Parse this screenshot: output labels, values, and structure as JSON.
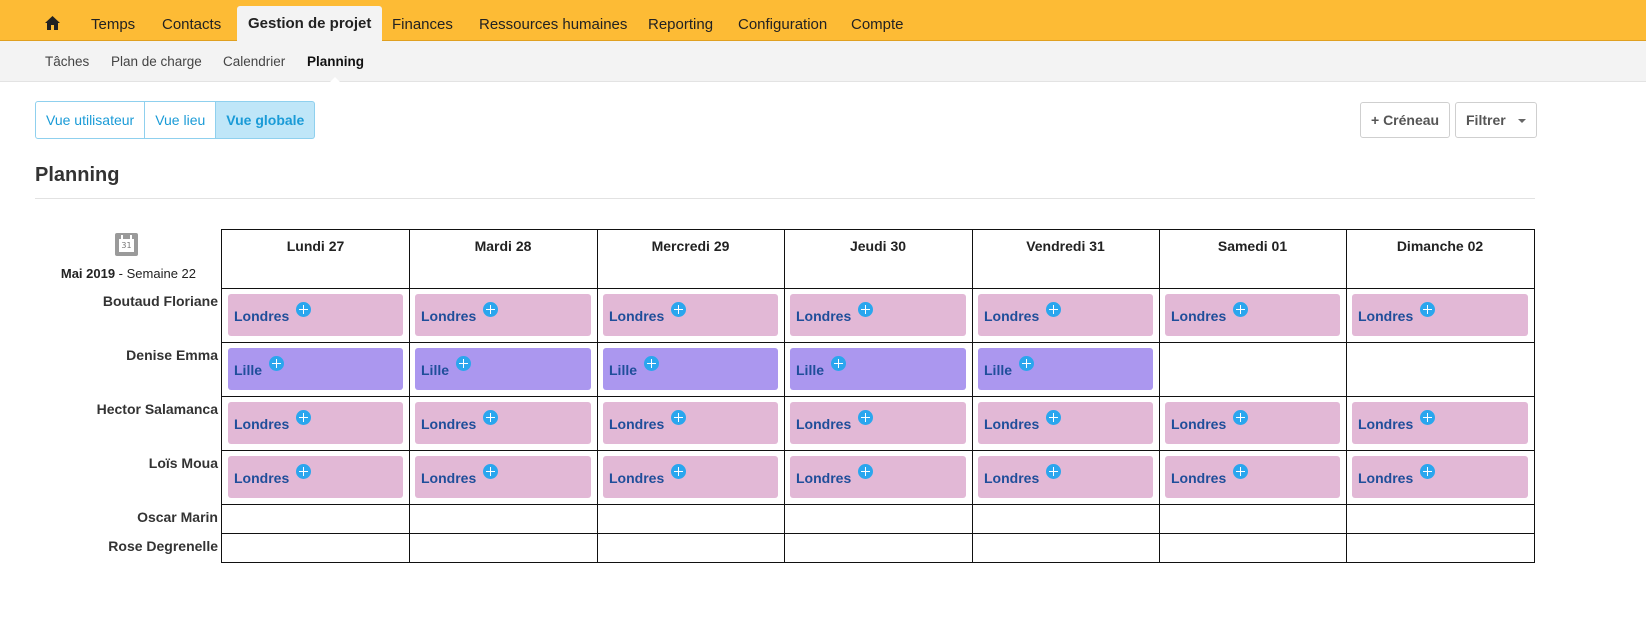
{
  "topnav": {
    "items": [
      "Temps",
      "Contacts",
      "Gestion de projet",
      "Finances",
      "Ressources humaines",
      "Reporting",
      "Configuration",
      "Compte"
    ],
    "active": "Gestion de projet"
  },
  "subnav": {
    "items": [
      "Tâches",
      "Plan de charge",
      "Calendrier",
      "Planning"
    ],
    "active": "Planning"
  },
  "views": [
    "Vue utilisateur",
    "Vue lieu",
    "Vue globale"
  ],
  "active_view": "Vue globale",
  "actions": {
    "add_slot": "+ Créneau",
    "filter": "Filtrer"
  },
  "page_title": "Planning",
  "calendar": {
    "icon_day": "31",
    "month": "Mai 2019",
    "week": " - Semaine 22"
  },
  "days": [
    "Lundi 27",
    "Mardi 28",
    "Mercredi 29",
    "Jeudi 30",
    "Vendredi 31",
    "Samedi 01",
    "Dimanche 02"
  ],
  "people": [
    {
      "name": "Boutaud Floriane",
      "slots": [
        "Londres",
        "Londres",
        "Londres",
        "Londres",
        "Londres",
        "Londres",
        "Londres"
      ]
    },
    {
      "name": "Denise Emma",
      "slots": [
        "Lille",
        "Lille",
        "Lille",
        "Lille",
        "Lille",
        null,
        null
      ]
    },
    {
      "name": "Hector Salamanca",
      "slots": [
        "Londres",
        "Londres",
        "Londres",
        "Londres",
        "Londres",
        "Londres",
        "Londres"
      ]
    },
    {
      "name": "Loïs Moua",
      "slots": [
        "Londres",
        "Londres",
        "Londres",
        "Londres",
        "Londres",
        "Londres",
        "Londres"
      ]
    },
    {
      "name": "Oscar Marin",
      "slots": [
        null,
        null,
        null,
        null,
        null,
        null,
        null
      ]
    },
    {
      "name": "Rose Degrenelle",
      "slots": [
        null,
        null,
        null,
        null,
        null,
        null,
        null
      ]
    }
  ],
  "colors": {
    "topbar": "#fdbb35",
    "londres": "#e2b8d6",
    "lille": "#ab97ef",
    "accent": "#1a9bd7"
  }
}
